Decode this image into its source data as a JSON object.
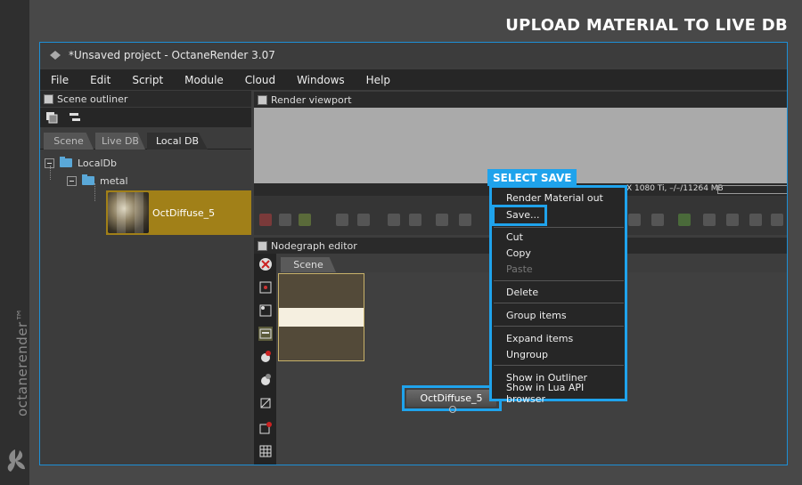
{
  "page": {
    "title": "UPLOAD MATERIAL TO LIVE DB",
    "brand": "octanerender"
  },
  "window": {
    "title": "*Unsaved project - OctaneRender 3.07"
  },
  "menu": [
    "File",
    "Edit",
    "Script",
    "Module",
    "Cloud",
    "Windows",
    "Help"
  ],
  "outliner": {
    "title": "Scene outliner",
    "tabs": [
      "Scene",
      "Live DB",
      "Local DB"
    ],
    "active_tab": "Local DB",
    "tree": {
      "root": "LocalDb",
      "folder": "metal",
      "material": "OctDiffuse_5"
    }
  },
  "viewport": {
    "title": "Render viewport",
    "status": "X 1080 Ti, –/–/11264 MB"
  },
  "nodegraph": {
    "title": "Nodegraph editor",
    "tab": "Scene",
    "node_label": "OctDiffuse_5"
  },
  "callout": "SELECT SAVE",
  "context_menu": {
    "items": [
      {
        "label": "Render Material out",
        "enabled": true
      },
      {
        "label": "Save...",
        "enabled": true
      },
      {
        "label": "Cut",
        "enabled": true
      },
      {
        "label": "Copy",
        "enabled": true
      },
      {
        "label": "Paste",
        "enabled": false
      },
      {
        "label": "Delete",
        "enabled": true
      },
      {
        "label": "Group items",
        "enabled": true
      },
      {
        "label": "Expand items",
        "enabled": true
      },
      {
        "label": "Ungroup",
        "enabled": true
      },
      {
        "label": "Show in Outliner",
        "enabled": true
      },
      {
        "label": "Show in Lua API browser",
        "enabled": true
      }
    ]
  },
  "colors": {
    "accent": "#1fa3ec",
    "selection": "#a18018"
  }
}
